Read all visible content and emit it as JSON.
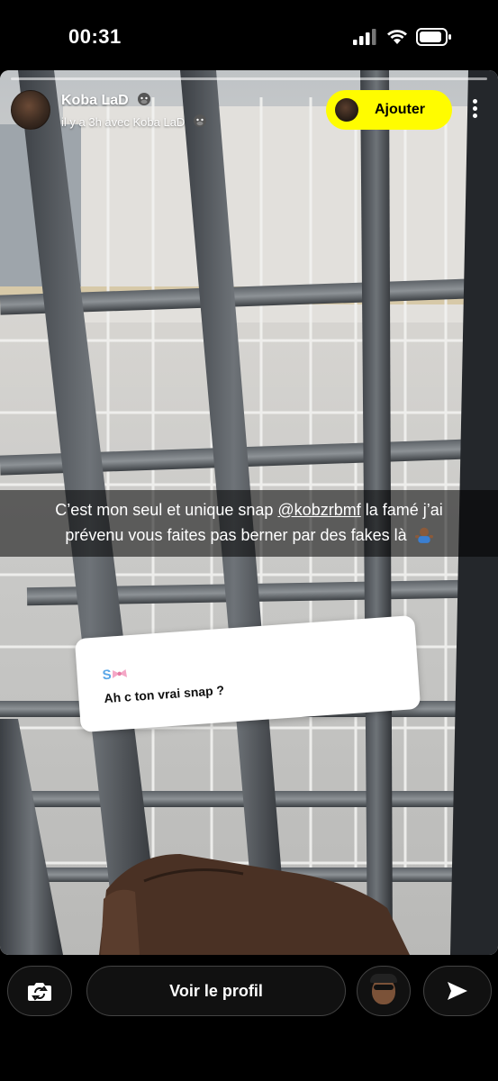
{
  "status_bar": {
    "time": "00:31"
  },
  "story": {
    "username": "Koba LaD",
    "subtitle": "il y a 3h avec Koba LaD",
    "add_button_label": "Ajouter",
    "caption_line1_pre": "C’est mon seul et unique snap ",
    "caption_mention": "@kobzrbmf",
    "caption_line1_post": " la famé j’ai",
    "caption_line2": "prévenu vous faites pas berner par des fakes là"
  },
  "question_card": {
    "name": "S",
    "question": "Ah c ton vrai snap ?"
  },
  "bottom_bar": {
    "view_profile_label": "Voir le profil"
  },
  "icons": [
    "signal-icon",
    "wifi-icon",
    "battery-icon",
    "more-icon",
    "camera-swap-icon",
    "send-icon",
    "bow-emoji",
    "gorilla-emoji",
    "shrug-emoji"
  ]
}
